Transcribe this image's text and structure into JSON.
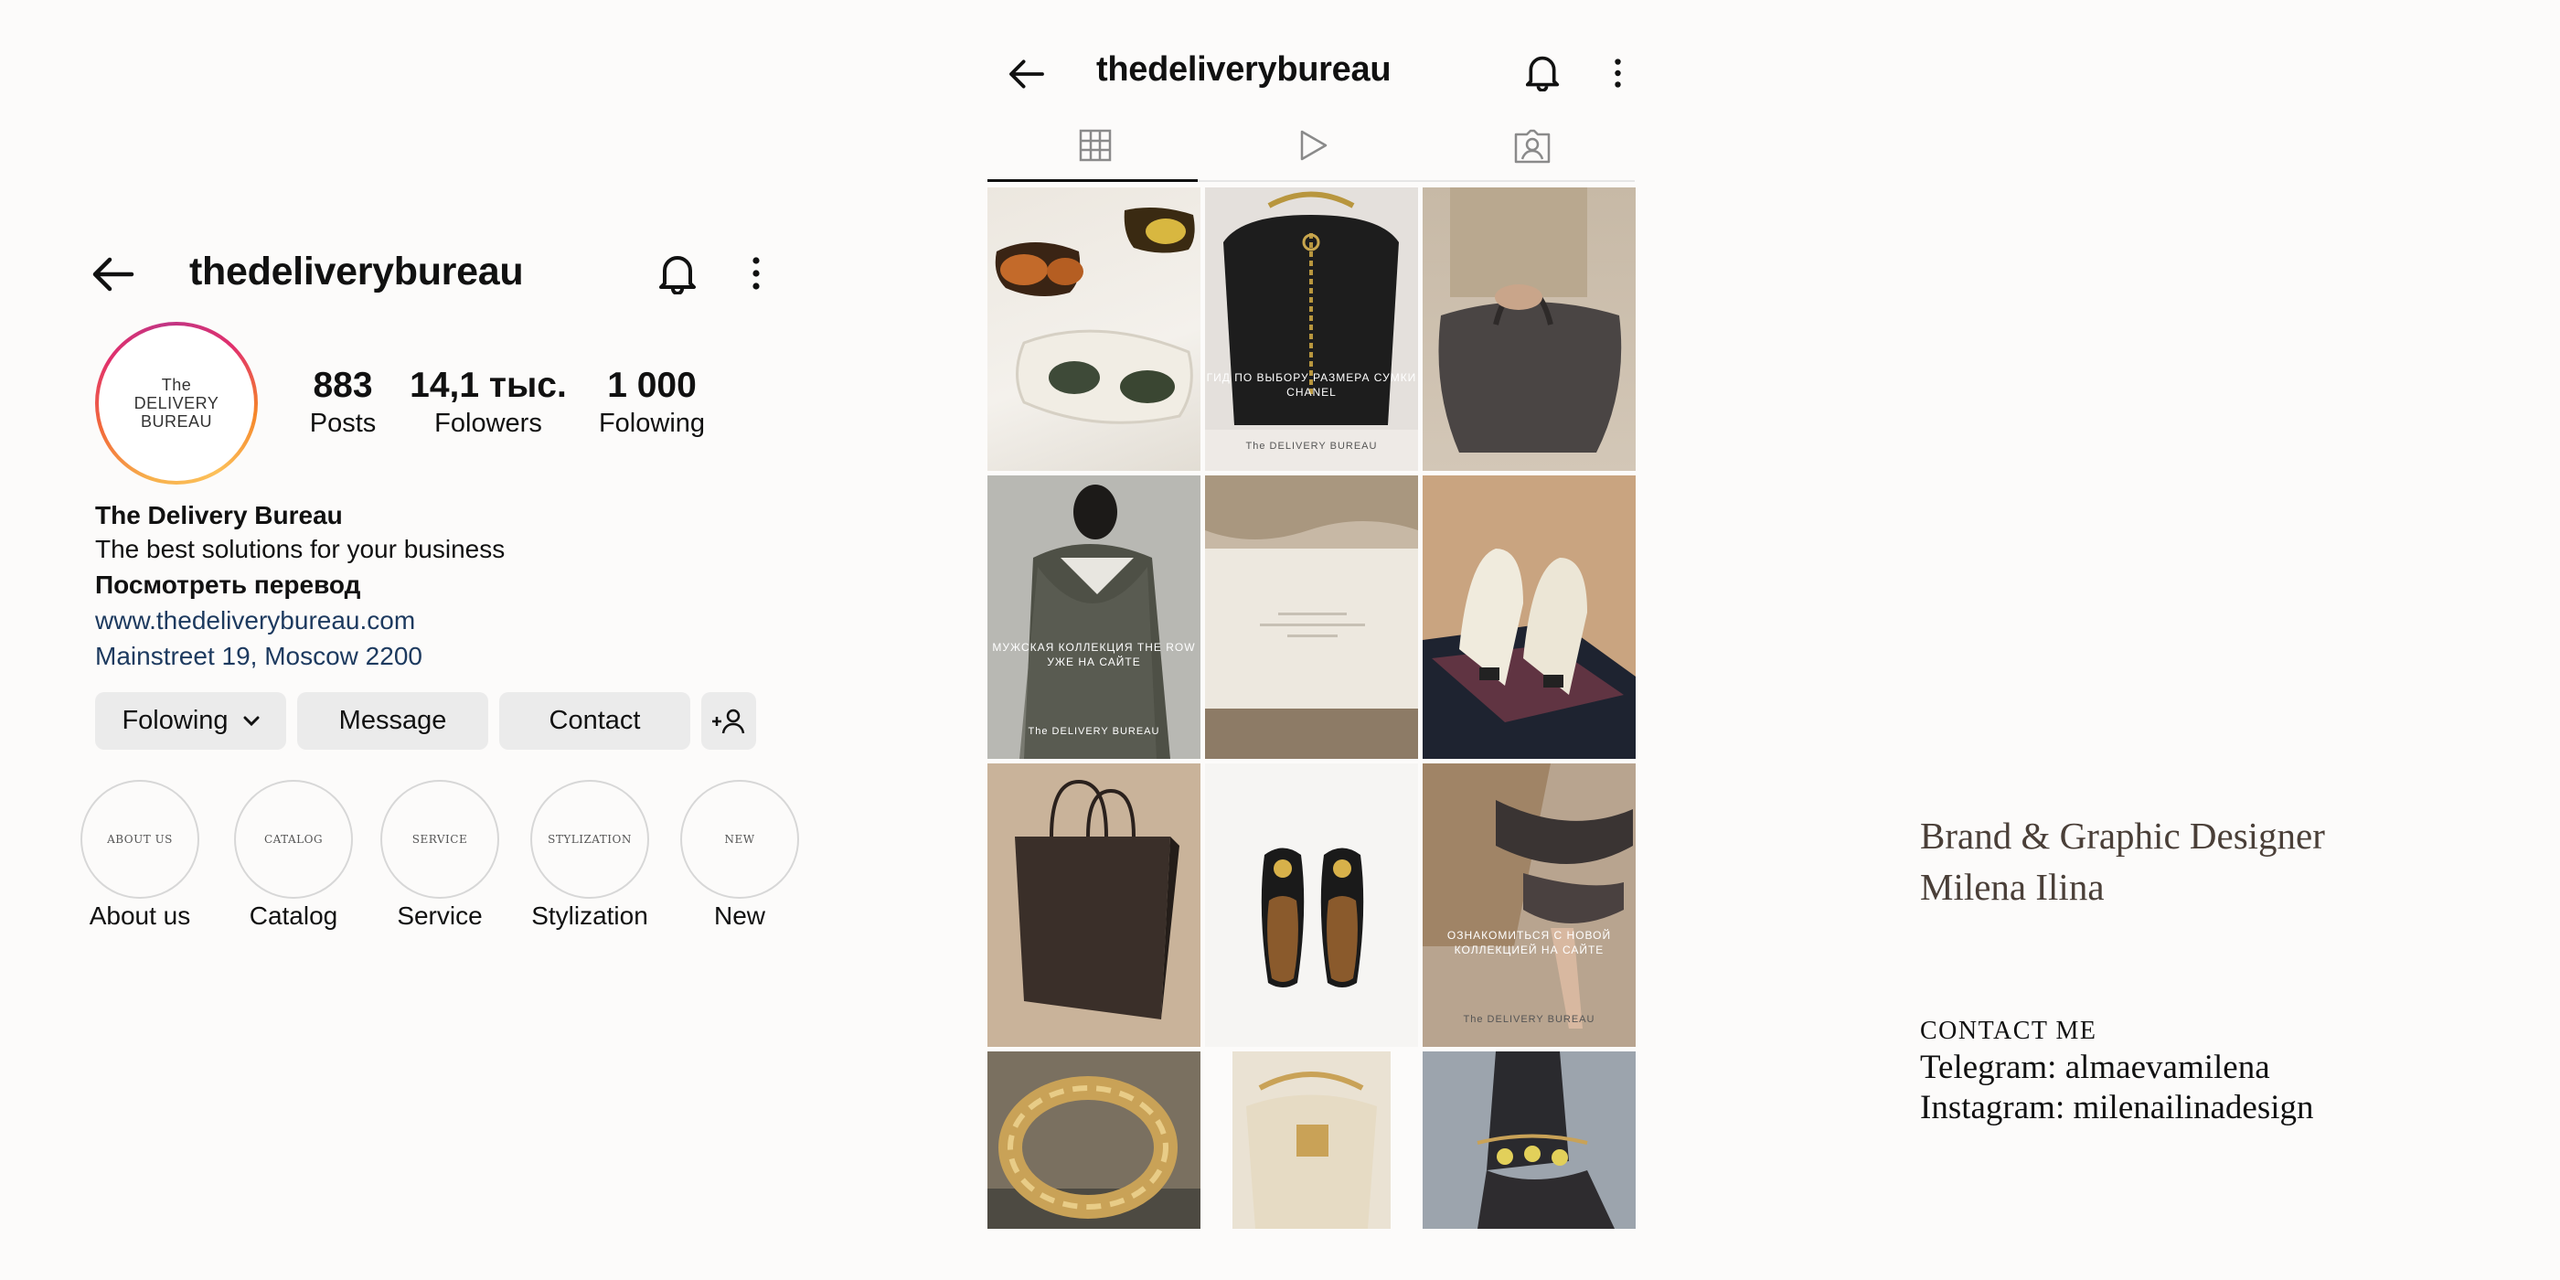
{
  "left_profile": {
    "username": "thedeliverybureau",
    "avatar": {
      "line1": "The",
      "line2": "DELIVERY BUREAU"
    },
    "stats": [
      {
        "value": "883",
        "label": "Posts"
      },
      {
        "value": "14,1 тыс.",
        "label": "Folowers"
      },
      {
        "value": "1 000",
        "label": "Folowing"
      }
    ],
    "bio": {
      "name": "The Delivery Bureau",
      "tagline": "The best solutions for your business",
      "translate": "Посмотреть перевод",
      "website": "www.thedeliverybureau.com",
      "address": "Mainstreet 19, Moscow 2200"
    },
    "buttons": {
      "following": "Folowing",
      "message": "Message",
      "contact": "Contact"
    },
    "highlights": [
      {
        "cover": "ABOUT US",
        "label": "About us"
      },
      {
        "cover": "CATALOG",
        "label": "Catalog"
      },
      {
        "cover": "SERVICE",
        "label": "Service"
      },
      {
        "cover": "STYLIZATION",
        "label": "Stylization"
      },
      {
        "cover": "NEW",
        "label": "New"
      }
    ],
    "icons": {
      "back": "arrow-left-icon",
      "bell": "bell-icon",
      "more": "more-vertical-icon",
      "add_user": "add-user-icon",
      "chevron": "chevron-down-icon"
    }
  },
  "grid_profile": {
    "username": "thedeliverybureau",
    "tabs": [
      "grid-icon",
      "reels-icon",
      "tagged-icon"
    ],
    "posts": [
      {
        "overlay": ""
      },
      {
        "overlay": "ГИД ПО ВЫБОРУ РАЗМЕРА СУМКИ CHANEL",
        "brand": "The DELIVERY BUREAU"
      },
      {
        "overlay": ""
      },
      {
        "overlay": "МУЖСКАЯ КОЛЛЕКЦИЯ THE ROW УЖЕ НА САЙТЕ",
        "brand": "The DELIVERY BUREAU"
      },
      {
        "overlay": ""
      },
      {
        "overlay": ""
      },
      {
        "overlay": ""
      },
      {
        "overlay": ""
      },
      {
        "overlay": "ОЗНАКОМИТЬСЯ С НОВОЙ КОЛЛЕКЦИЕЙ НА САЙТЕ",
        "brand": "The DELIVERY BUREAU"
      },
      {
        "overlay": ""
      },
      {
        "overlay": ""
      },
      {
        "overlay": ""
      }
    ]
  },
  "designer": {
    "role": "Brand & Graphic Designer",
    "name": "Milena Ilina",
    "contact_heading": "CONTACT ME",
    "telegram": "Telegram: almaevamilena",
    "instagram": "Instagram: milenailinadesign"
  }
}
